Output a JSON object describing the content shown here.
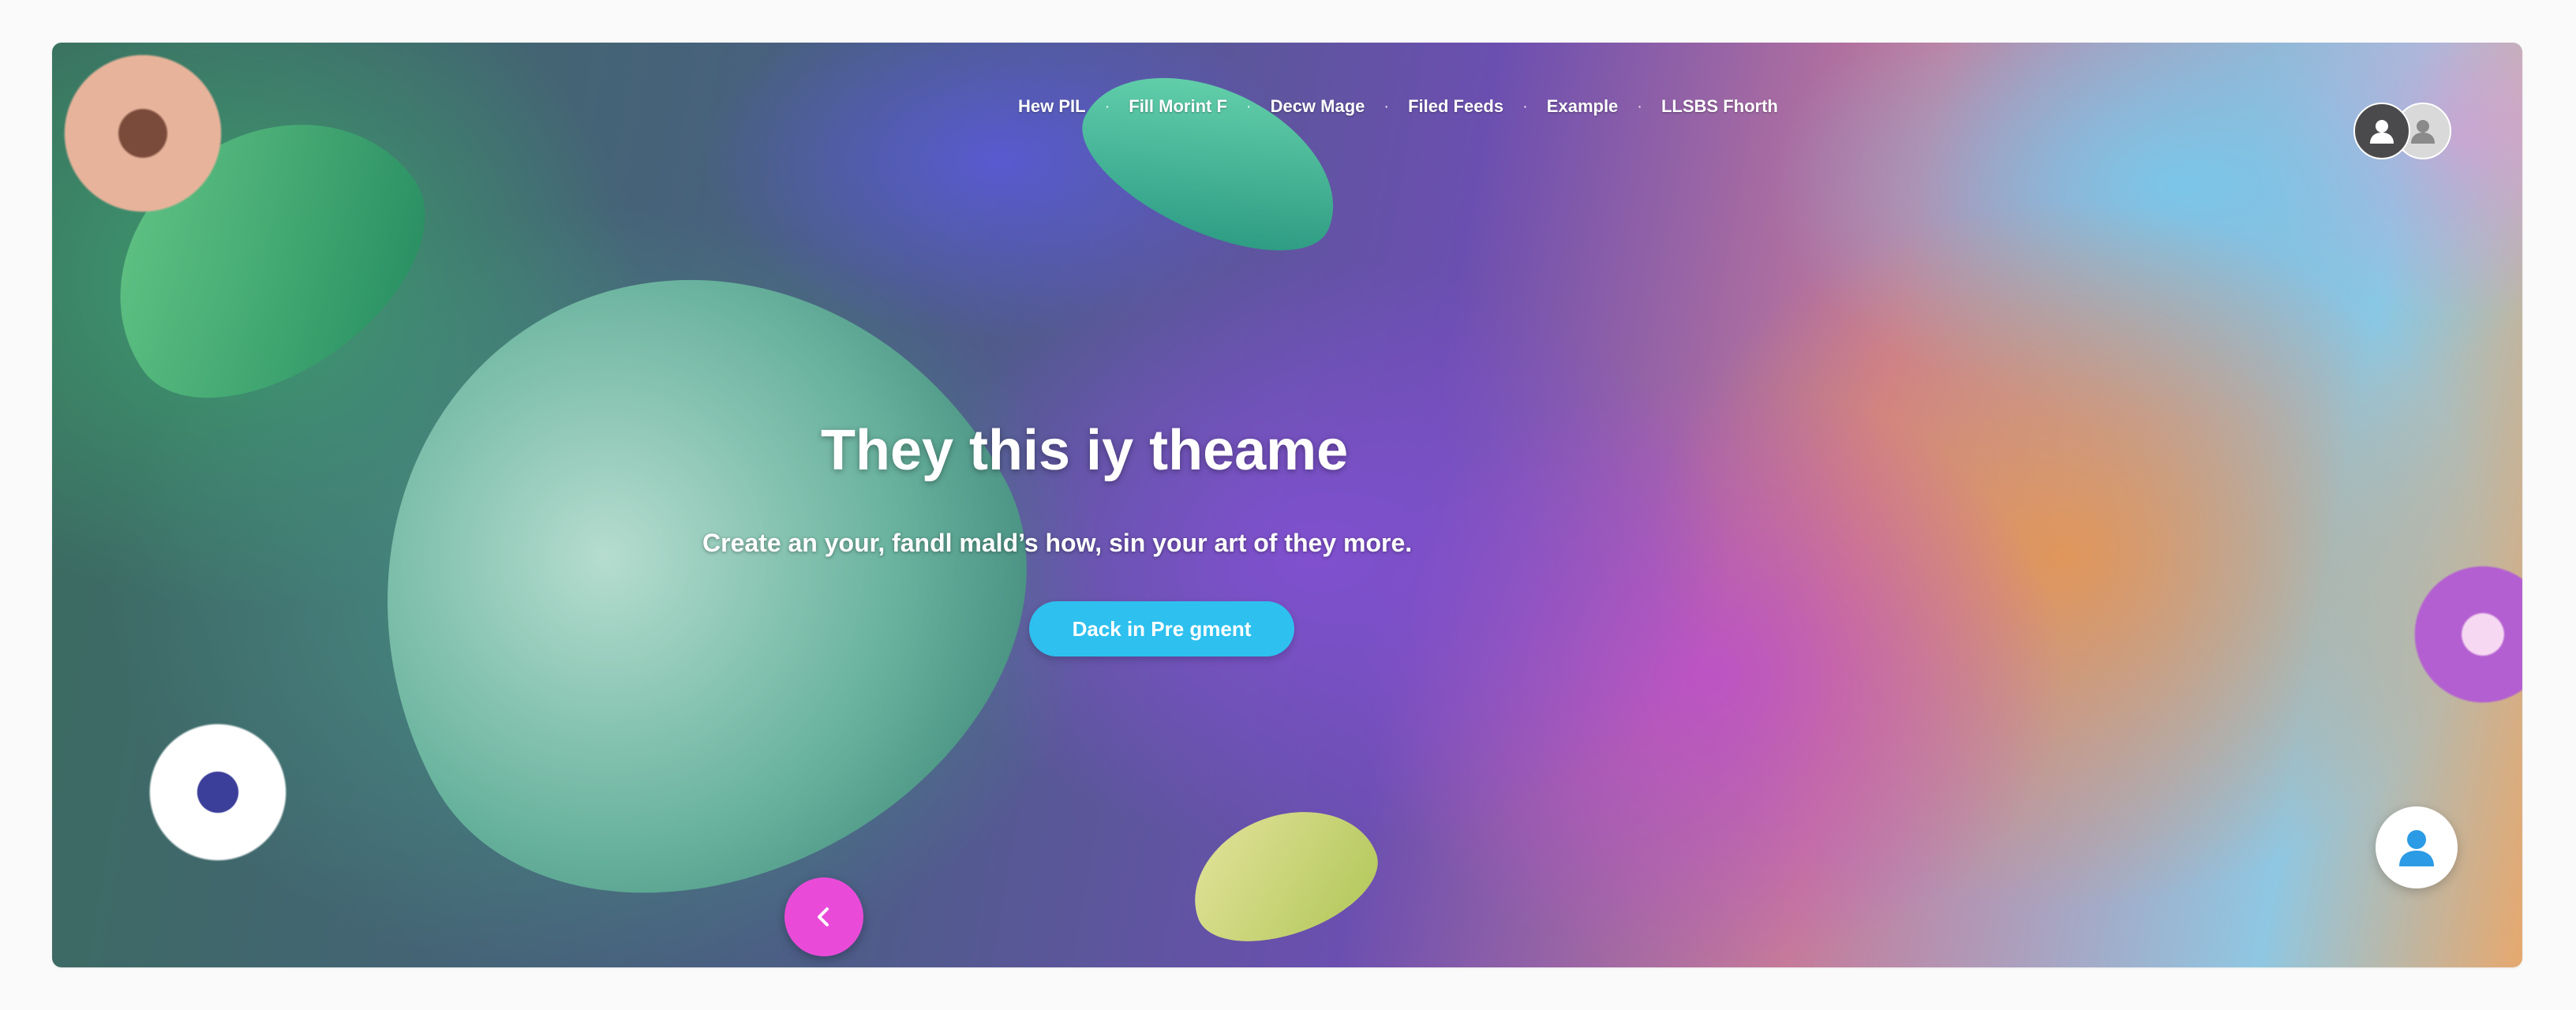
{
  "nav": {
    "items": [
      {
        "label": "Hew PIL"
      },
      {
        "label": "Fill Morint F"
      },
      {
        "label": "Decw Mage"
      },
      {
        "label": "Filed Feeds"
      },
      {
        "label": "Example"
      },
      {
        "label": "LLSBS Fhorth"
      }
    ]
  },
  "hero": {
    "title": "They this iy theame",
    "subtitle": "Create an your, fandl mald’s how, sin your art of they more.",
    "cta_label": "Dack in Pre gment"
  },
  "colors": {
    "cta": "#2ec0ee",
    "prev_button": "#e94bd8",
    "avatar_dark": "#4a4a4c",
    "user_icon": "#2b9be5"
  },
  "icons": {
    "avatar_primary": "user-silhouette-icon",
    "avatar_secondary": "user-silhouette-icon",
    "prev": "chevron-left-icon",
    "fab": "user-icon"
  }
}
